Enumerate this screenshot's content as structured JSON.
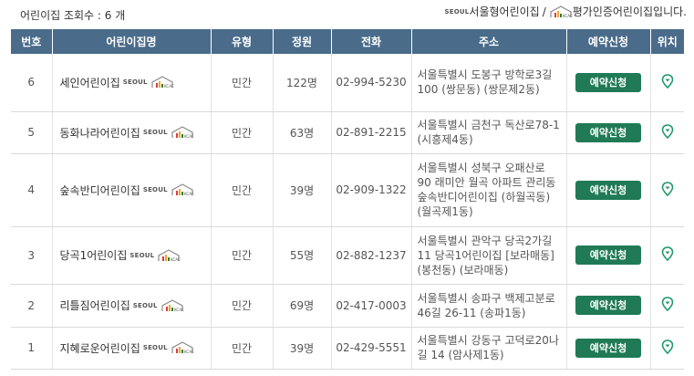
{
  "header": {
    "count_label": "어린이집 조회수 : 6 개",
    "seoul_type_label": "서울형어린이집",
    "separator": "/",
    "accredited_label": "평가인증어린이집입니다."
  },
  "logos": {
    "seoul_text": "SEOUL",
    "kcac_text": "KCAC"
  },
  "colors": {
    "header_bg": "#4a6b8a",
    "button_bg": "#1f7a55",
    "accent_green": "#1f9a6a"
  },
  "table": {
    "columns": [
      "번호",
      "어린이집명",
      "유형",
      "정원",
      "전화",
      "주소",
      "예약신청",
      "위치"
    ],
    "rows": [
      {
        "no": "6",
        "name": "세인어린이집",
        "type": "민간",
        "capacity": "122명",
        "phone": "02-994-5230",
        "address": "서울특별시 도봉구 방학로3길 100 (쌍문동) (쌍문제2동)",
        "reserve": "예약신청"
      },
      {
        "no": "5",
        "name": "동화나라어린이집",
        "type": "민간",
        "capacity": "63명",
        "phone": "02-891-2215",
        "address": "서울특별시 금천구 독산로78-1 (시흥제4동)",
        "reserve": "예약신청"
      },
      {
        "no": "4",
        "name": "숲속반디어린이집",
        "type": "민간",
        "capacity": "39명",
        "phone": "02-909-1322",
        "address": "서울특별시 성북구 오패산로 90 래미안 월곡 아파트 관리동 숲속반디어린이집 (하월곡동) (월곡제1동)",
        "reserve": "예약신청"
      },
      {
        "no": "3",
        "name": "당곡1어린이집",
        "type": "민간",
        "capacity": "55명",
        "phone": "02-882-1237",
        "address": "서울특별시 관악구 당곡2가길 11 당곡1어린이집 [보라매동] (봉천동) (보라매동)",
        "reserve": "예약신청"
      },
      {
        "no": "2",
        "name": "리틀짐어린이집",
        "type": "민간",
        "capacity": "69명",
        "phone": "02-417-0003",
        "address": "서울특별시 송파구 백제고분로46길 26-11 (송파1동)",
        "reserve": "예약신청"
      },
      {
        "no": "1",
        "name": "지혜로운어린이집",
        "type": "민간",
        "capacity": "39명",
        "phone": "02-429-5551",
        "address": "서울특별시 강동구 고덕로20나길 14 (암사제1동)",
        "reserve": "예약신청"
      }
    ]
  },
  "icons": {
    "location": "map-pin-icon",
    "seoul": "seoul-logo-icon",
    "kcac": "kcac-accreditation-icon"
  }
}
